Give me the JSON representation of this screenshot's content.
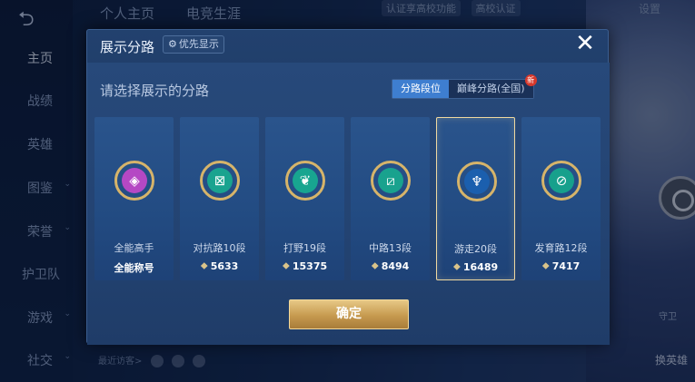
{
  "background": {
    "top_tabs": [
      "个人主页",
      "电竞生涯"
    ],
    "top_strip": [
      "认证享高校功能",
      "高校认证"
    ],
    "settings": "设置",
    "nav_items": [
      "主页",
      "战绩",
      "英雄",
      "图鉴",
      "荣誉",
      "护卫队",
      "游戏",
      "社交"
    ],
    "recent_visitors": "最近访客>",
    "guard_label": "守卫",
    "switch_hero": "换英雄"
  },
  "modal": {
    "title": "展示分路",
    "priority_label": "优先显示",
    "prompt": "请选择展示的分路",
    "segments": [
      "分路段位",
      "巅峰分路(全国)"
    ],
    "new_badge": "新",
    "confirm": "确定",
    "cards": [
      {
        "label": "全能高手",
        "value": "全能称号",
        "core_color": "#b548c4",
        "selected": false,
        "has_rank_icon": false
      },
      {
        "label": "对抗路10段",
        "value": "5633",
        "core_color": "#1aa38f",
        "selected": false,
        "has_rank_icon": true
      },
      {
        "label": "打野19段",
        "value": "15375",
        "core_color": "#18a590",
        "selected": false,
        "has_rank_icon": true
      },
      {
        "label": "中路13段",
        "value": "8494",
        "core_color": "#19a28e",
        "selected": false,
        "has_rank_icon": true
      },
      {
        "label": "游走20段",
        "value": "16489",
        "core_color": "#1b5fae",
        "selected": true,
        "has_rank_icon": true
      },
      {
        "label": "发育路12段",
        "value": "7417",
        "core_color": "#17a08c",
        "selected": false,
        "has_rank_icon": true
      }
    ]
  },
  "colors": {
    "accent_gold": "#d6b46a",
    "segment_active": "#3e7ed0",
    "confirm_gold": "#c69a4f"
  }
}
